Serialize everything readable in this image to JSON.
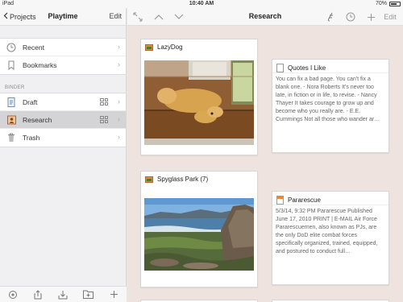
{
  "status_bar": {
    "device": "iPad",
    "time": "10:40 AM",
    "battery": "70%",
    "battery_level": 0.7
  },
  "sidebar": {
    "back_label": "Projects",
    "title": "Playtime",
    "edit_label": "Edit",
    "top_items": [
      {
        "label": "Recent",
        "icon": "clock-icon"
      },
      {
        "label": "Bookmarks",
        "icon": "bookmark-icon"
      }
    ],
    "section_label": "BINDER",
    "binder_items": [
      {
        "label": "Draft",
        "icon": "draft-document-icon"
      },
      {
        "label": "Research",
        "icon": "research-folder-icon",
        "selected": true
      },
      {
        "label": "Trash",
        "icon": "trash-icon"
      }
    ]
  },
  "toolbar": {
    "title": "Research"
  },
  "cards": [
    {
      "title": "LazyDog",
      "type": "image"
    },
    {
      "title": "Quotes I Like",
      "type": "text",
      "text": "You can fix a bad page. You can't fix a blank one. - Nora Roberts It's never too late, in fiction or in life, to revise. - Nancy Thayer It takes courage to grow up and become who you really are. - E.E. Cummings Not all those who wander ar…"
    },
    {
      "title": "Spyglass Park (7)",
      "type": "image"
    },
    {
      "title": "Pararescue",
      "type": "text",
      "text": "5/3/14, 9:32 PM Pararescue Published June 17, 2010 PRINT | E-MAIL Air Force Pararescuemen, also known as PJs, are the only DoD elite combat forces specifically organized, trained, equipped, and postured to conduct full…"
    }
  ],
  "colors": {
    "accent": "#e58a3a",
    "corkboard": "#efe3df",
    "selected_row": "#d4d4d6"
  }
}
